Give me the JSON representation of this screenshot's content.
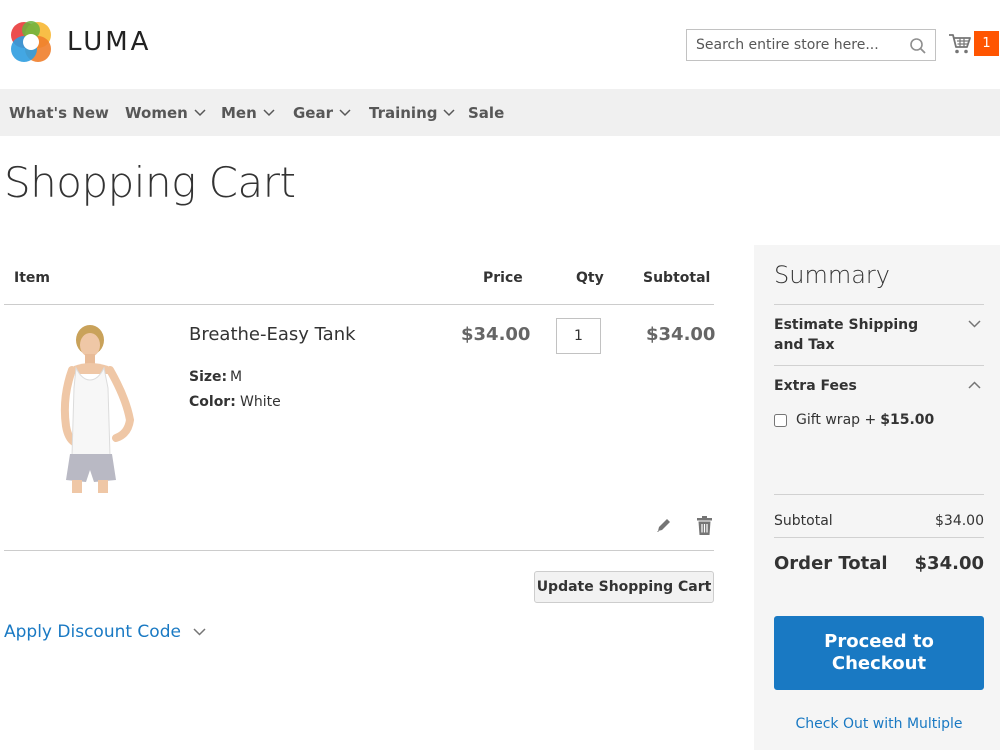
{
  "header": {
    "logo_text": "LUMA",
    "search_placeholder": "Search entire store here...",
    "cart_count": "1",
    "colors": {
      "cart_badge": "#ff5501",
      "accent": "#1979c3"
    }
  },
  "nav": {
    "items": [
      {
        "label": "What's New",
        "has_dropdown": false
      },
      {
        "label": "Women",
        "has_dropdown": true
      },
      {
        "label": "Men",
        "has_dropdown": true
      },
      {
        "label": "Gear",
        "has_dropdown": true
      },
      {
        "label": "Training",
        "has_dropdown": true
      },
      {
        "label": "Sale",
        "has_dropdown": false
      }
    ]
  },
  "page": {
    "title": "Shopping Cart"
  },
  "cart": {
    "columns": {
      "item": "Item",
      "price": "Price",
      "qty": "Qty",
      "subtotal": "Subtotal"
    },
    "rows": [
      {
        "name": "Breathe-Easy Tank",
        "options": [
          {
            "label": "Size:",
            "value": "M"
          },
          {
            "label": "Color:",
            "value": "White"
          }
        ],
        "price": "$34.00",
        "qty": "1",
        "subtotal": "$34.00"
      }
    ],
    "update_button": "Update Shopping Cart",
    "discount_label": "Apply Discount Code"
  },
  "summary": {
    "title": "Summary",
    "shipping_title": "Estimate Shipping and Tax",
    "extra_fees_title": "Extra Fees",
    "gift_wrap_label": "Gift wrap +",
    "gift_wrap_price": "$15.00",
    "subtotal_label": "Subtotal",
    "subtotal_value": "$34.00",
    "order_total_label": "Order Total",
    "order_total_value": "$34.00",
    "checkout_button": "Proceed to Checkout",
    "multi_address_link": "Check Out with Multiple"
  }
}
